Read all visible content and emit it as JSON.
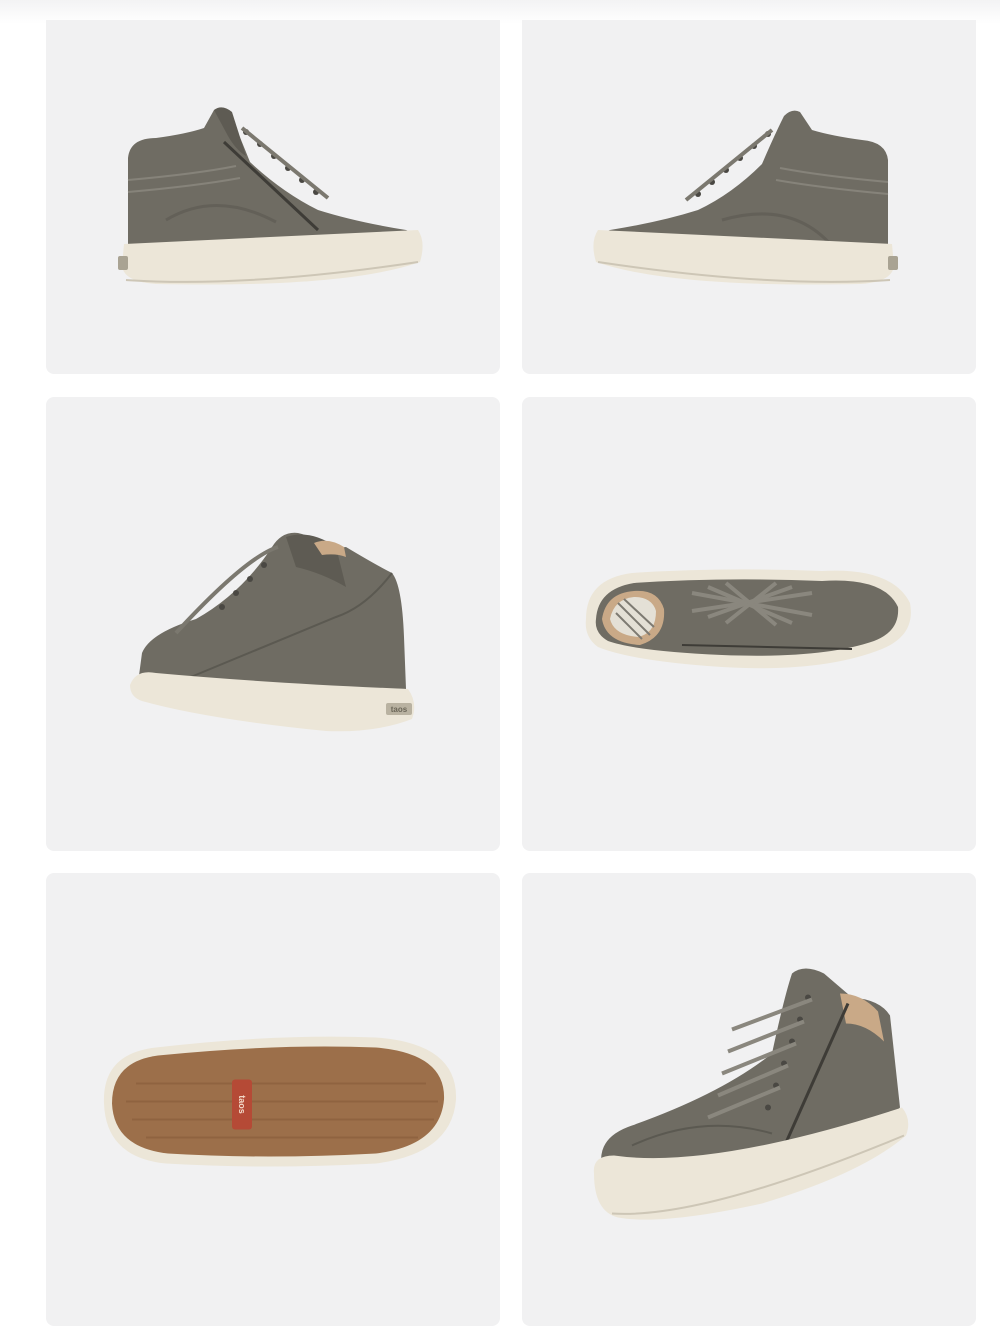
{
  "gallery": {
    "images": [
      {
        "view": "side-outer",
        "icon": "sneaker-side-icon"
      },
      {
        "view": "side-inner",
        "icon": "sneaker-side-icon"
      },
      {
        "view": "back-three-quarter",
        "icon": "sneaker-back-icon"
      },
      {
        "view": "top",
        "icon": "sneaker-top-icon"
      },
      {
        "view": "outsole",
        "icon": "sneaker-sole-icon"
      },
      {
        "view": "front-three-quarter",
        "icon": "sneaker-front-icon"
      }
    ],
    "logo_text": "taos",
    "colors": {
      "tile_background": "#f1f1f2",
      "upper": "#6f6c63",
      "upper_dark": "#5b5951",
      "midsole": "#ece6d8",
      "outsole": "#9c6f4a",
      "logo_red": "#b54a36"
    }
  }
}
